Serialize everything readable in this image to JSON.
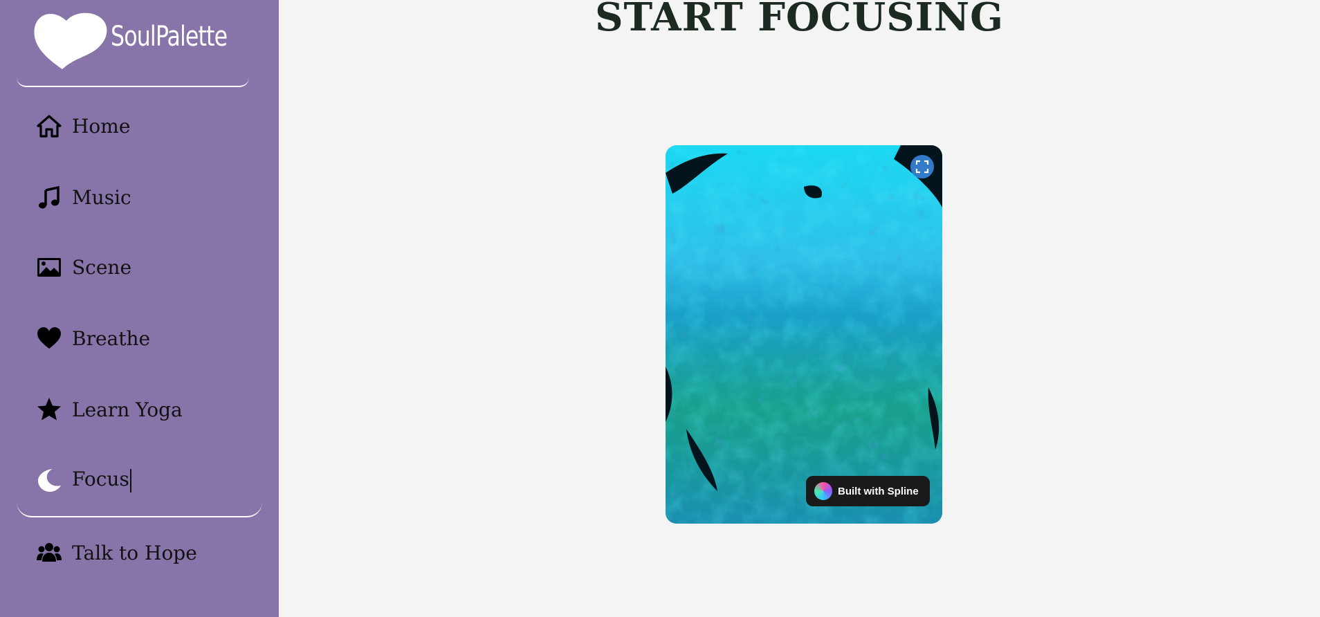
{
  "brand": {
    "name": "SoulPalette",
    "logo_icon": "heart-icon"
  },
  "nav": {
    "items": [
      {
        "label": "Home",
        "icon": "home-icon"
      },
      {
        "label": "Music",
        "icon": "music-note-icon"
      },
      {
        "label": "Scene",
        "icon": "image-icon"
      },
      {
        "label": "Breathe",
        "icon": "heart-icon"
      },
      {
        "label": "Learn Yoga",
        "icon": "star-icon"
      },
      {
        "label": "Focus",
        "icon": "moon-icon",
        "active": true
      },
      {
        "label": "Talk to Hope",
        "icon": "users-icon"
      }
    ]
  },
  "main": {
    "title": "START FOCUSING",
    "scene": {
      "badge_text": "Built with Spline",
      "fullscreen_icon": "fullscreen-icon"
    }
  },
  "colors": {
    "sidebar_bg": "#8775a9",
    "page_bg": "#f4f4f4",
    "title": "#1c2a22",
    "accent_white": "#ffffff"
  }
}
